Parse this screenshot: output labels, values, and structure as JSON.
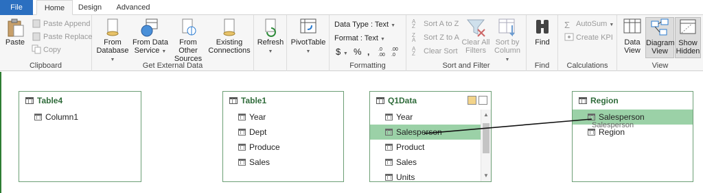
{
  "tabs": [
    "File",
    "Home",
    "Design",
    "Advanced"
  ],
  "clipboard": {
    "group": "Clipboard",
    "paste": "Paste",
    "paste_append": "Paste Append",
    "paste_replace": "Paste Replace",
    "copy": "Copy"
  },
  "external": {
    "group": "Get External Data",
    "from_database_1": "From",
    "from_database_2": "Database",
    "from_service_1": "From Data",
    "from_service_2": "Service",
    "from_other_1": "From Other",
    "from_other_2": "Sources",
    "existing_1": "Existing",
    "existing_2": "Connections"
  },
  "refresh": {
    "label": "Refresh"
  },
  "pivot": {
    "label": "PivotTable"
  },
  "formatting": {
    "group": "Formatting",
    "data_type": "Data Type : Text",
    "format": "Format : Text",
    "currency": "$",
    "percent": "%",
    "comma": "ɒ",
    "inc_dec": ".0 .00",
    "dec_dec": ".00 .0"
  },
  "sortfilter": {
    "group": "Sort and Filter",
    "sort_az": "Sort A to Z",
    "sort_za": "Sort Z to A",
    "clear_sort": "Clear Sort",
    "clear_all_1": "Clear All",
    "clear_all_2": "Filters",
    "sort_col_1": "Sort by",
    "sort_col_2": "Column"
  },
  "find": {
    "group": "Find",
    "label": "Find"
  },
  "calculations": {
    "group": "Calculations",
    "autosum": "AutoSum",
    "create_kpi": "Create KPI"
  },
  "view": {
    "group": "View",
    "data_view_1": "Data",
    "data_view_2": "View",
    "diagram_view_1": "Diagram",
    "diagram_view_2": "View",
    "show_hidden_1": "Show",
    "show_hidden_2": "Hidden"
  },
  "tables": {
    "table4": {
      "name": "Table4",
      "columns": [
        "Column1"
      ]
    },
    "table1": {
      "name": "Table1",
      "columns": [
        "Year",
        "Dept",
        "Produce",
        "Sales"
      ]
    },
    "q1data": {
      "name": "Q1Data",
      "columns": [
        "Year",
        "Salesperson",
        "Product",
        "Sales",
        "Units"
      ]
    },
    "region": {
      "name": "Region",
      "columns": [
        "Salesperson",
        "Region"
      ]
    }
  },
  "drag_ghost": "Salesperson",
  "colors": {
    "file_tab": "#2b6fc0",
    "selected_row": "#9bd1a7",
    "table_title": "#2f6b3a",
    "table_border": "#6b9e74"
  }
}
